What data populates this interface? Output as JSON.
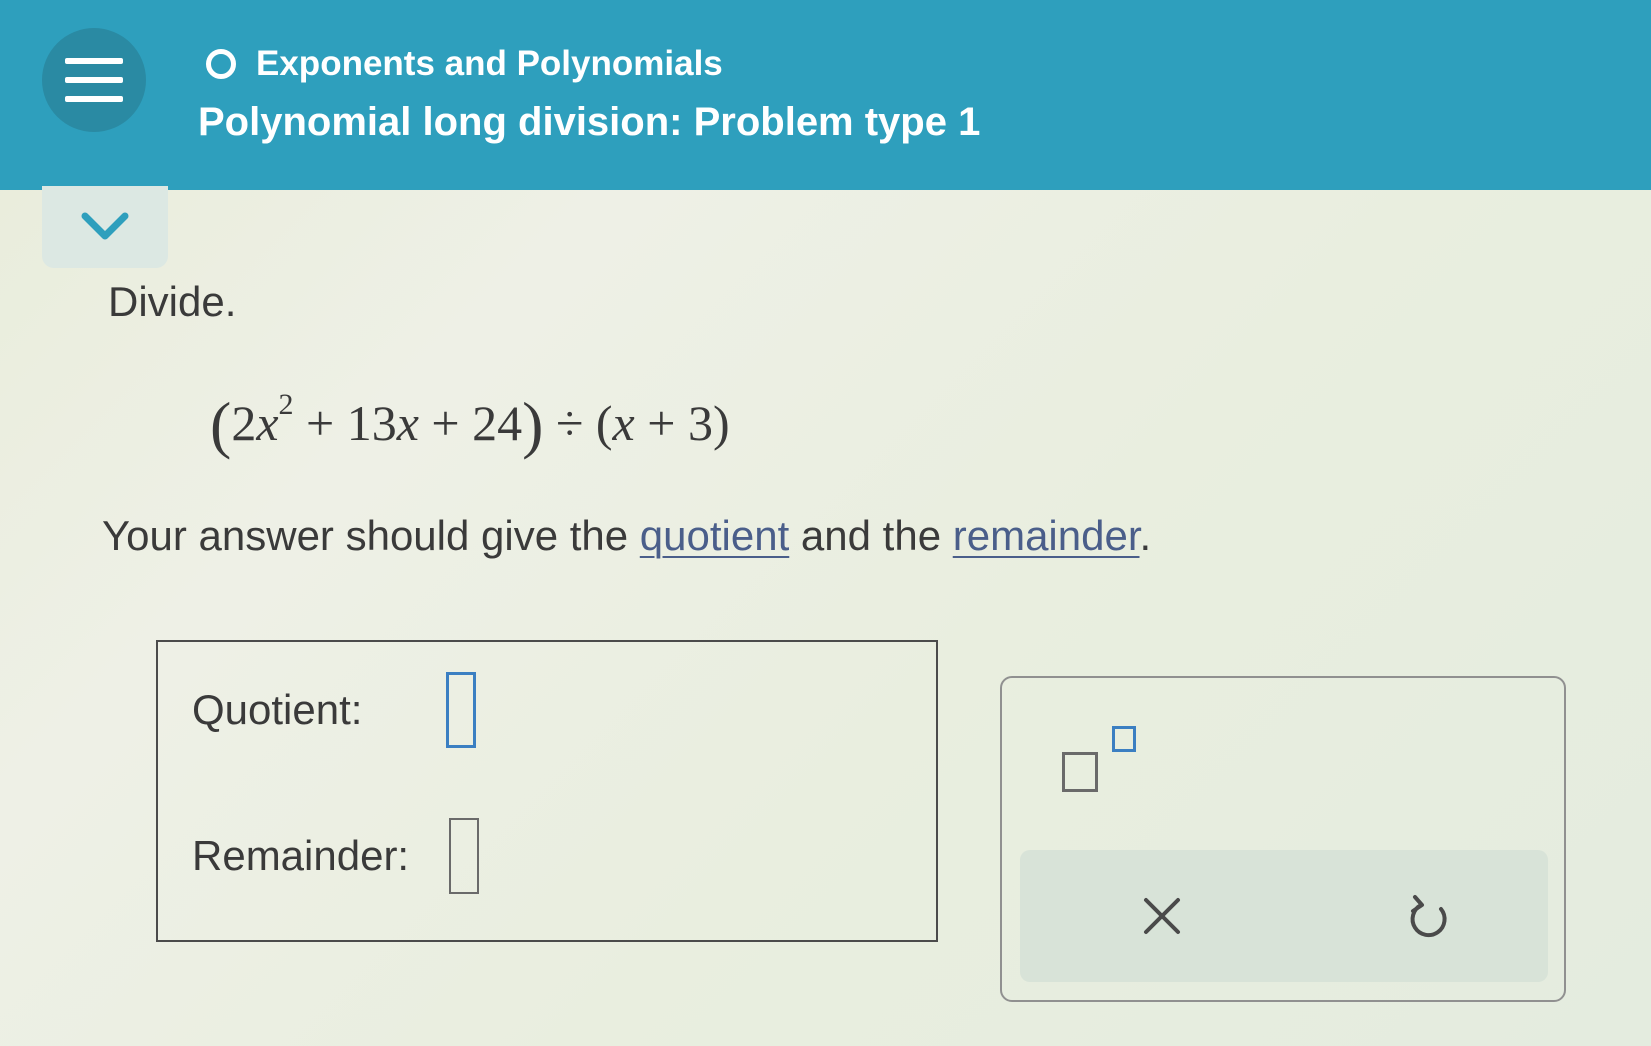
{
  "header": {
    "menu_icon": "hamburger-menu-icon",
    "topic_icon": "circle-outline-icon",
    "topic": "Exponents and Polynomials",
    "title": "Polynomial long division: Problem type 1",
    "background_color": "#2e9fbd"
  },
  "collapse_icon": "chevron-down-icon",
  "problem": {
    "instruction": "Divide.",
    "expression": {
      "open_paren": "(",
      "lead_coef": "2",
      "var1": "x",
      "exponent": "2",
      "term2": "+ 13",
      "var2": "x",
      "term3": "+ 24",
      "close_paren": ")",
      "divide_sign": "÷",
      "open_paren2": "(",
      "var3": "x",
      "term4": "+ 3",
      "close_paren2": ")"
    },
    "answer_prefix": "Your answer should give the ",
    "quotient_link": "quotient",
    "answer_middle": " and the ",
    "remainder_link": "remainder",
    "answer_suffix": "."
  },
  "answer": {
    "quotient_label": "Quotient:",
    "quotient_value": "",
    "remainder_label": "Remainder:",
    "remainder_value": ""
  },
  "toolbox": {
    "exponent_icon": "exponent-template-icon",
    "clear_icon": "close-icon",
    "undo_icon": "undo-icon"
  }
}
